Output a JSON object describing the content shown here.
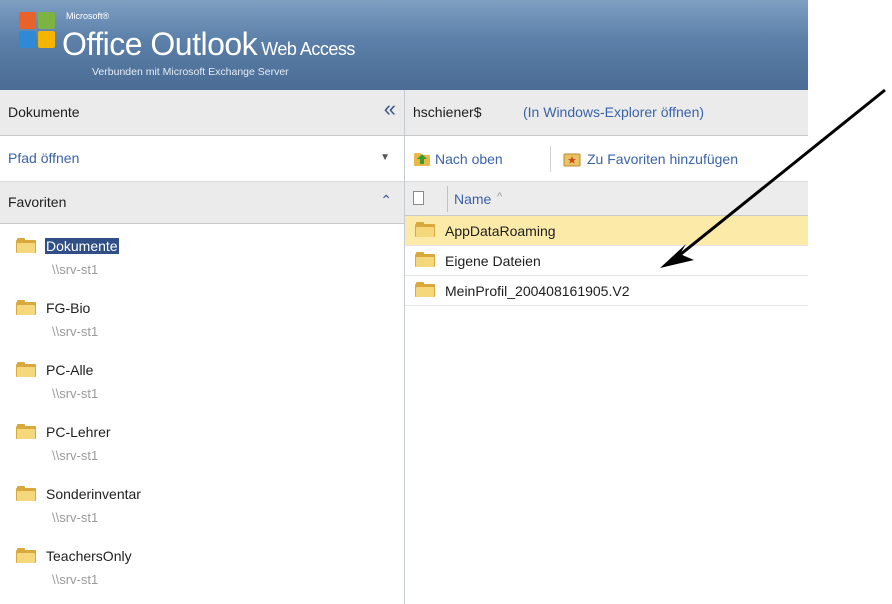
{
  "header": {
    "ms_label": "Microsoft®",
    "product": "Office Outlook",
    "product_suffix": "Web Access",
    "connected": "Verbunden mit Microsoft Exchange Server"
  },
  "left_pane": {
    "title": "Dokumente",
    "collapse_glyph": "«",
    "open_path": "Pfad öffnen",
    "favorites_title": "Favoriten",
    "favorites": [
      {
        "name": "Dokumente",
        "server": "\\\\srv-st1"
      },
      {
        "name": "FG-Bio",
        "server": "\\\\srv-st1"
      },
      {
        "name": "PC-Alle",
        "server": "\\\\srv-st1"
      },
      {
        "name": "PC-Lehrer",
        "server": "\\\\srv-st1"
      },
      {
        "name": "Sonderinventar",
        "server": "\\\\srv-st1"
      },
      {
        "name": "TeachersOnly",
        "server": "\\\\srv-st1"
      }
    ]
  },
  "right_pane": {
    "current_path": "hschiener$",
    "open_in_explorer": "(In Windows-Explorer öffnen)",
    "toolbar": {
      "up": "Nach oben",
      "add_favorite": "Zu Favoriten hinzufügen"
    },
    "column_name": "Name",
    "files": [
      {
        "name": "AppDataRoaming"
      },
      {
        "name": "Eigene Dateien"
      },
      {
        "name": "MeinProfil_200408161905.V2"
      }
    ]
  },
  "colors": {
    "banner": "#5b7fa8",
    "link": "#3a63a8",
    "selection": "#2f4f86",
    "row_highlight": "#fbeaa8"
  }
}
